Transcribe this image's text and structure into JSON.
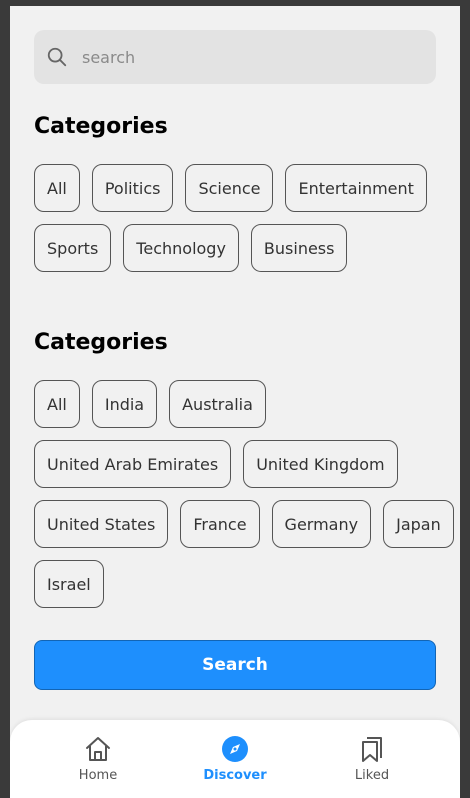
{
  "search": {
    "placeholder": "search"
  },
  "sections": [
    {
      "title": "Categories",
      "rows": [
        [
          "All",
          "Politics",
          "Science",
          "Entertainment"
        ],
        [
          "Sports",
          "Technology",
          "Business"
        ]
      ]
    },
    {
      "title": "Categories",
      "rows": [
        [
          "All",
          "India",
          "Australia"
        ],
        [
          "United Arab Emirates",
          "United Kingdom"
        ],
        [
          "United States",
          "France",
          "Germany",
          "Japan"
        ],
        [
          "Israel"
        ]
      ]
    }
  ],
  "submit": {
    "label": "Search"
  },
  "nav": {
    "items": [
      {
        "label": "Home",
        "icon": "home-icon",
        "active": false
      },
      {
        "label": "Discover",
        "icon": "compass-icon",
        "active": true
      },
      {
        "label": "Liked",
        "icon": "bookmarks-icon",
        "active": false
      }
    ]
  },
  "colors": {
    "accent": "#1e8ffd",
    "background": "#f1f1f1",
    "frame": "#3a3a3a"
  }
}
